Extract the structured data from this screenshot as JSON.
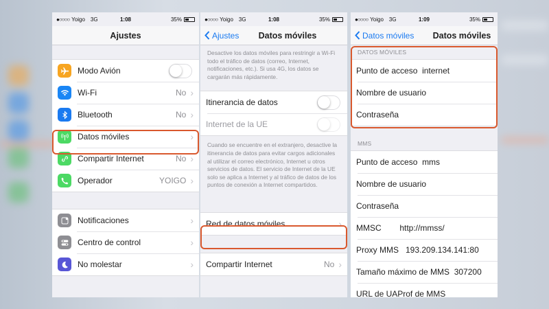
{
  "colors": {
    "accent": "#1a7af0",
    "highlight": "#d9582d",
    "airplane": "#f7a521",
    "wifi": "#1a86f5",
    "bluetooth": "#1a7af0",
    "cellular": "#4cd964",
    "hotspot": "#4cd964",
    "carrier": "#4cd964",
    "notifications": "#8e8e93",
    "control": "#8e8e93",
    "dnd": "#5856d6"
  },
  "screen1": {
    "status": {
      "carrier": "Yoigo",
      "network": "3G",
      "time": "1:08",
      "battery": "35%"
    },
    "title": "Ajustes",
    "group1": [
      {
        "label": "Modo Avión",
        "icon": "airplane-icon",
        "control": "toggle"
      },
      {
        "label": "Wi-Fi",
        "icon": "wifi-icon",
        "value": "No"
      },
      {
        "label": "Bluetooth",
        "icon": "bluetooth-icon",
        "value": "No"
      },
      {
        "label": "Datos móviles",
        "icon": "cellular-icon",
        "value": ""
      },
      {
        "label": "Compartir Internet",
        "icon": "hotspot-icon",
        "value": "No"
      },
      {
        "label": "Operador",
        "icon": "phone-icon",
        "value": "YOIGO"
      }
    ],
    "group2": [
      {
        "label": "Notificaciones",
        "icon": "notifications-icon"
      },
      {
        "label": "Centro de control",
        "icon": "control-center-icon"
      },
      {
        "label": "No molestar",
        "icon": "moon-icon"
      }
    ]
  },
  "screen2": {
    "status": {
      "carrier": "Yoigo",
      "network": "3G",
      "time": "1:08",
      "battery": "35%"
    },
    "back": "Ajustes",
    "title": "Datos móviles",
    "top_note": "Desactive los datos móviles para restringir a Wi-Fi todo el tráfico de datos (correo, Internet, notificaciones, etc.). Si usa 4G, los datos se cargarán más rápidamente.",
    "roaming_label": "Itinerancia de datos",
    "eu_label": "Internet de la UE",
    "roaming_note": "Cuando se encuentre en el extranjero, desactive la itinerancia de datos para evitar cargos adicionales al utilizar el correo electrónico, Internet u otros servicios de datos. El servicio de Internet de la UE solo se aplica a Internet y al tráfico de datos de los puntos de conexión a Internet compartidos.",
    "network_label": "Red de datos móviles",
    "share_label": "Compartir Internet",
    "share_value": "No"
  },
  "screen3": {
    "status": {
      "carrier": "Yoigo",
      "network": "3G",
      "time": "1:09",
      "battery": "35%"
    },
    "back": "Datos móviles",
    "title": "Datos móviles",
    "section1": "DATOS MÓVILES",
    "rows1": [
      "Punto de acceso  internet",
      "Nombre de usuario",
      "Contraseña"
    ],
    "section2": "MMS",
    "rows2": [
      "Punto de acceso  mms",
      "Nombre de usuario",
      "Contraseña",
      "MMSC        http://mmss/",
      "Proxy MMS   193.209.134.141:80",
      "Tamaño máximo de MMS  307200",
      "URL de UAProf de MMS"
    ]
  }
}
